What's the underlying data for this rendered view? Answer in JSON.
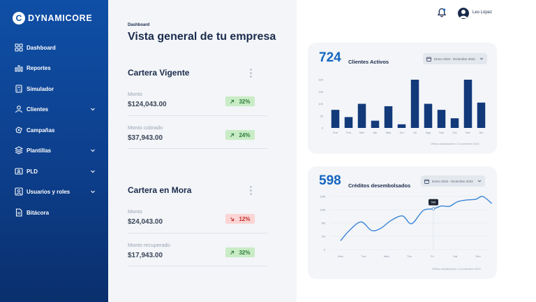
{
  "brand": {
    "logo_letter": "C",
    "name": "DYNAMICORE"
  },
  "sidebar": {
    "items": [
      {
        "label": "Dashboard",
        "icon": "dashboard-icon",
        "chevron": false
      },
      {
        "label": "Reportes",
        "icon": "bar-chart-icon",
        "chevron": false
      },
      {
        "label": "Simulador",
        "icon": "calculator-icon",
        "chevron": false
      },
      {
        "label": "Clientes",
        "icon": "user-icon",
        "chevron": true
      },
      {
        "label": "Campañas",
        "icon": "campaign-icon",
        "chevron": false
      },
      {
        "label": "Plantillas",
        "icon": "layers-icon",
        "chevron": true
      },
      {
        "label": "PLD",
        "icon": "id-card-icon",
        "chevron": true
      },
      {
        "label": "Usuarios y roles",
        "icon": "users-icon",
        "chevron": true
      },
      {
        "label": "Bitácora",
        "icon": "document-icon",
        "chevron": false
      }
    ]
  },
  "header": {
    "breadcrumb": "Dashboard",
    "title": "Vista general de tu empresa"
  },
  "cartera_vigente": {
    "title": "Cartera Vigente",
    "monto_label": "Monto",
    "monto_value": "$124,043.00",
    "monto_change": "32%",
    "monto_trend": "up",
    "cobrado_label": "Monto cobrado",
    "cobrado_value": "$37,943.00",
    "cobrado_change": "24%",
    "cobrado_trend": "up"
  },
  "cartera_mora": {
    "title": "Cartera en Mora",
    "monto_label": "Monto",
    "monto_value": "$24,043.00",
    "monto_change": "12%",
    "monto_trend": "down",
    "recuperado_label": "Monto recuperado",
    "recuperado_value": "$17,943.00",
    "recuperado_change": "32%",
    "recuperado_trend": "up"
  },
  "user": {
    "name": "Leo López"
  },
  "clientes_card": {
    "number": "724",
    "label": "Clientes Activos",
    "date_range": "Enero 2022  -  Diciembre 2022",
    "footer": "Última actualización: 5 noviembre 2022"
  },
  "creditos_card": {
    "number": "598",
    "label": "Créditos desembolsados",
    "date_range": "Enero 2022  -  Diciembre 2022",
    "footer": "Última actualización: 5 noviembre 2022"
  },
  "colors": {
    "primary": "#1565c0",
    "bar": "#12397a",
    "line": "#3a85d6",
    "up": "#2d7a3a",
    "down": "#c42b2b"
  },
  "chart_data": [
    {
      "type": "bar",
      "categories": [
        "Ene",
        "Feb",
        "Mar",
        "Abr",
        "May",
        "Jun",
        "Jul",
        "Ago",
        "Sep",
        "Oct",
        "Nov",
        "Dic"
      ],
      "values": [
        75,
        45,
        100,
        30,
        90,
        15,
        200,
        100,
        75,
        40,
        200,
        105
      ],
      "yticks": [
        "200",
        "150",
        "100",
        "50",
        "0"
      ],
      "ylim": [
        0,
        200
      ]
    },
    {
      "type": "line",
      "categories": [
        "Mon",
        "Tue",
        "Wed",
        "Thu",
        "Fri",
        "Sat",
        "Sun"
      ],
      "yticks": [
        "15M",
        "10M",
        "5M",
        "1M",
        "0"
      ],
      "tooltip": "598",
      "points": [
        [
          0,
          2.5
        ],
        [
          0.4,
          5.5
        ],
        [
          0.9,
          7.8
        ],
        [
          1.35,
          5.4
        ],
        [
          1.75,
          6.0
        ],
        [
          2.2,
          8.2
        ],
        [
          2.7,
          9.5
        ],
        [
          3.1,
          7.3
        ],
        [
          3.6,
          11.0
        ],
        [
          4.05,
          11.5
        ],
        [
          4.4,
          12.3
        ],
        [
          4.75,
          12.2
        ],
        [
          5.1,
          13.5
        ],
        [
          5.5,
          14.0
        ],
        [
          5.9,
          14.2
        ],
        [
          6.2,
          15.0
        ],
        [
          6.6,
          13.0
        ]
      ]
    }
  ]
}
